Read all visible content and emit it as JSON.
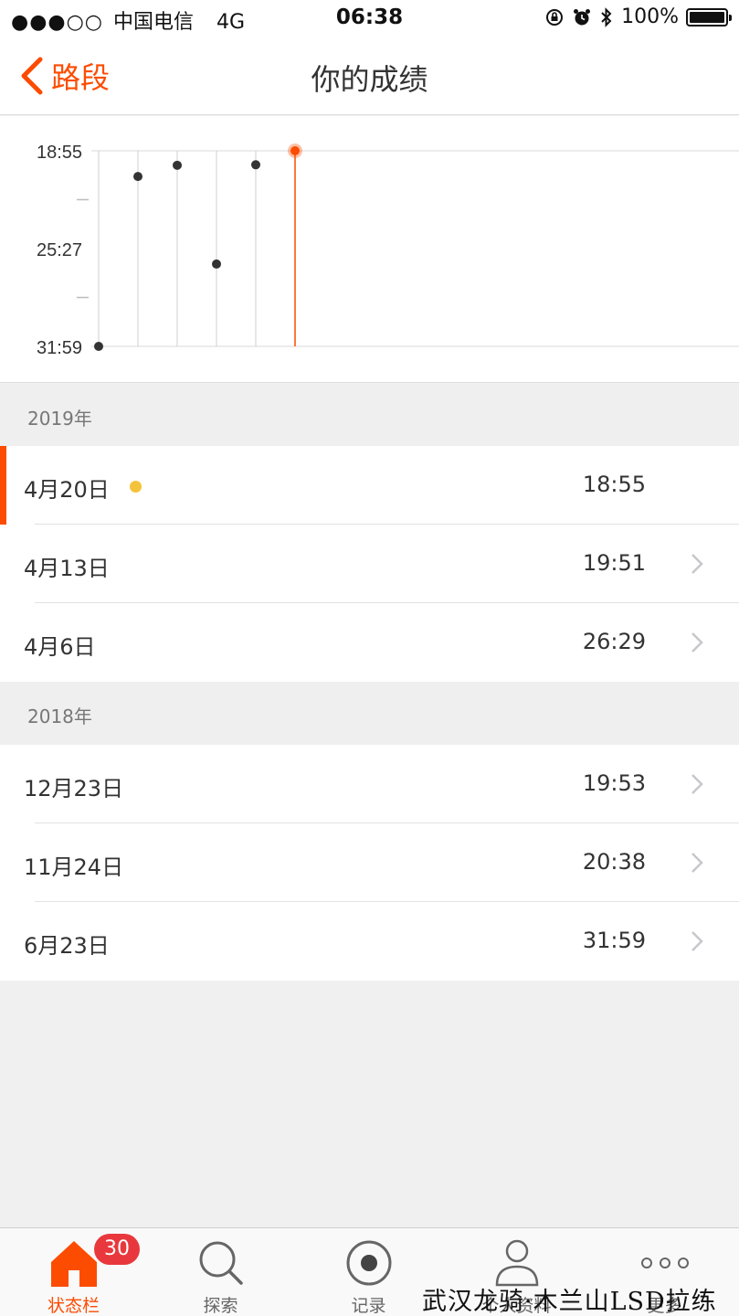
{
  "status_bar": {
    "signal": "●●●○○",
    "carrier": "中国电信",
    "network": "4G",
    "time": "06:38",
    "battery": "100%"
  },
  "nav": {
    "back_label": "路段",
    "title": "你的成绩"
  },
  "chart_data": {
    "type": "scatter",
    "y_tick_labels": [
      "18:55",
      "25:27",
      "31:59"
    ],
    "y_axis": "time, inverted (faster at top)",
    "x_order": "chronological, oldest to newest",
    "points": [
      {
        "date": "6月23日",
        "time": "31:59"
      },
      {
        "date": "11月24日",
        "time": "20:38"
      },
      {
        "date": "12月23日",
        "time": "19:53"
      },
      {
        "date": "4月6日",
        "time": "26:29"
      },
      {
        "date": "4月13日",
        "time": "19:51"
      },
      {
        "date": "4月20日",
        "time": "18:55",
        "highlighted": true
      }
    ],
    "colors": {
      "point": "#333333",
      "highlight": "#fc4c02"
    }
  },
  "sections": [
    {
      "year": "2019年",
      "rows": [
        {
          "date": "4月20日",
          "time": "18:55",
          "selected": true,
          "best": true
        },
        {
          "date": "4月13日",
          "time": "19:51"
        },
        {
          "date": "4月6日",
          "time": "26:29"
        }
      ]
    },
    {
      "year": "2018年",
      "rows": [
        {
          "date": "12月23日",
          "time": "19:53"
        },
        {
          "date": "11月24日",
          "time": "20:38"
        },
        {
          "date": "6月23日",
          "time": "31:59"
        }
      ]
    }
  ],
  "tabbar": {
    "tabs": [
      {
        "label": "状态栏",
        "icon": "home-icon",
        "active": true,
        "badge": "30"
      },
      {
        "label": "探索",
        "icon": "search-icon"
      },
      {
        "label": "记录",
        "icon": "record-icon"
      },
      {
        "label": "个人资料",
        "icon": "profile-icon"
      },
      {
        "label": "更多",
        "icon": "more-icon"
      }
    ]
  },
  "watermark": "武汉龙骑·木兰山LSD拉练",
  "colors": {
    "accent": "#fc4c02",
    "badge": "#e8383d",
    "best_dot": "#f5c33b"
  }
}
